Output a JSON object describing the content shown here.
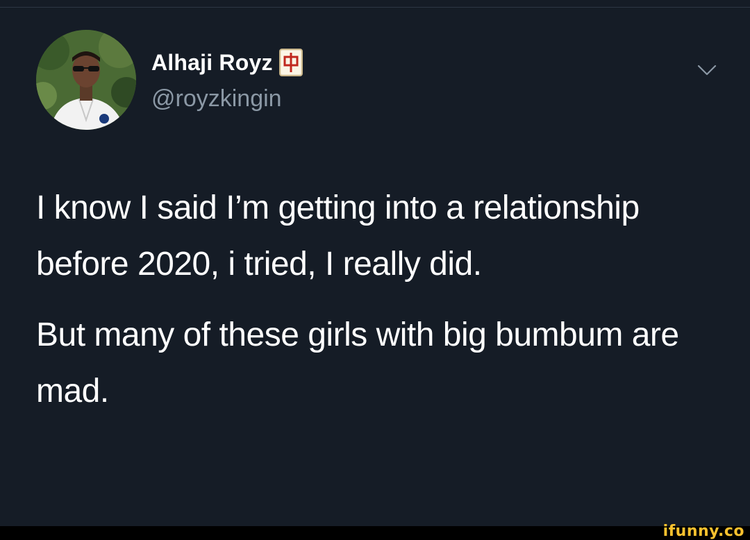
{
  "tweet": {
    "author": {
      "display_name": "Alhaji Royz",
      "name_emoji": "mahjong-red-dragon",
      "handle": "@royzkingin"
    },
    "menu_icon": "chevron-down-icon",
    "paragraphs": [
      "I know I said I’m getting into a relationship before 2020, i tried, I really did.",
      "But many of these girls with big bumbum are mad."
    ]
  },
  "watermark": {
    "text": "ifunny.co"
  },
  "colors": {
    "background": "#151c26",
    "text": "#ffffff",
    "handle": "#8b98a5",
    "watermark": "#f9c12e"
  }
}
